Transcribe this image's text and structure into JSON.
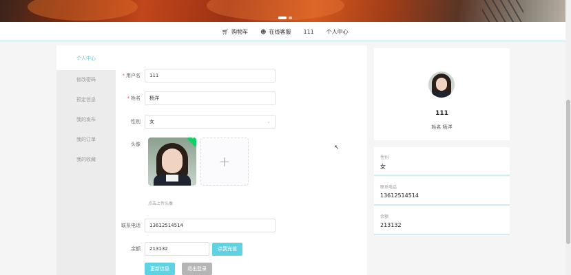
{
  "nav": {
    "items": [
      {
        "icon": "cart-icon",
        "label": "购物车"
      },
      {
        "icon": "user-service-icon",
        "label": "在线客服"
      },
      {
        "icon": "",
        "label": "111"
      },
      {
        "icon": "",
        "label": "个人中心"
      }
    ]
  },
  "sidebar": {
    "items": [
      "个人中心",
      "修改密码",
      "预定信息",
      "我的发布",
      "我的订单",
      "我的收藏"
    ],
    "active": "个人中心"
  },
  "form": {
    "username_label": "用户名",
    "username_value": "111",
    "name_label": "姓名",
    "name_value": "杨洋",
    "gender_label": "性别",
    "gender_value": "女",
    "avatar_label": "头像",
    "upload_tip": "点击上传头像",
    "phone_label": "联系电话",
    "phone_value": "13612514514",
    "balance_label": "余额",
    "balance_value": "213132",
    "recharge_button": "点我充值",
    "update_button": "更新信息",
    "logout_button": "退出登录"
  },
  "profile": {
    "name": "111",
    "sub": "姓名 杨洋"
  },
  "info": [
    {
      "label": "性别",
      "value": "女"
    },
    {
      "label": "联系电话",
      "value": "13612514514"
    },
    {
      "label": "余额",
      "value": "213132"
    }
  ],
  "colors": {
    "accent": "#5cc7d8",
    "button_cyan": "#60d3e3",
    "button_gray": "#b5b5b5"
  }
}
